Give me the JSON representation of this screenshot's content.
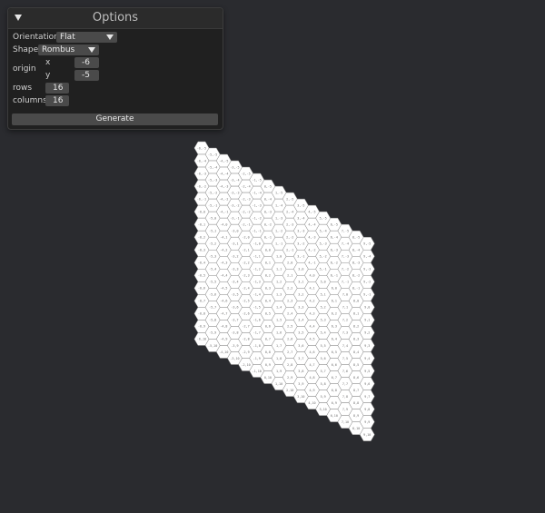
{
  "panel": {
    "title": "Options",
    "orientation_label": "Orientation",
    "orientation_value": "Flat",
    "shape_label": "Shape",
    "shape_value": "Rombus",
    "origin_label": "origin",
    "x_label": "x",
    "x_value": "-6",
    "y_label": "y",
    "y_value": "-5",
    "rows_label": "rows",
    "rows_value": "16",
    "columns_label": "columns",
    "columns_value": "16",
    "generate_label": "Generate"
  },
  "grid": {
    "origin_q": -6,
    "origin_r": -5,
    "rows": 16,
    "columns": 16,
    "cell_fill": "#ffffff",
    "cell_stroke": "#8a8a8a",
    "label_color": "#6e6e6e"
  }
}
